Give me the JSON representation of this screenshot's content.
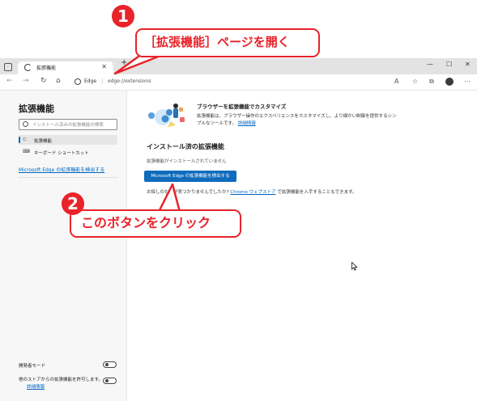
{
  "browser": {
    "tab_title": "拡張機能",
    "tab_close": "✕",
    "new_tab": "+",
    "address_site": "Edge",
    "address_separator": "|",
    "address_url": "edge://extensions",
    "window_controls": [
      "—",
      "☐",
      "✕"
    ]
  },
  "sidebar": {
    "title": "拡張機能",
    "search_placeholder": "インストール済みの拡張機能の検索",
    "nav_items": [
      {
        "label": "拡張機能"
      },
      {
        "label": "キーボード ショートカット"
      }
    ],
    "store_link": "Microsoft Edge の拡張機能を検出する",
    "toggles": [
      {
        "label": "開発者モード",
        "link": ""
      },
      {
        "label": "他のストアからの拡張機能を許可します。",
        "link": "詳細情報"
      }
    ]
  },
  "main": {
    "promo_title": "ブラウザーを拡張機能でカスタマイズ",
    "promo_desc": "拡張機能は、ブラウザー操作のエクスペリエンスをカスタマイズし、より細かい制御を提供するシンプルなツールです。",
    "promo_link": "詳細情報",
    "section_title": "インストール済の拡張機能",
    "empty_text": "拡張機能がインストールされていません",
    "discover_button": "Microsoft Edge の拡張機能を検出する",
    "hint_prefix": "お探しのもの",
    "hint_mid": "が見つかりませんでしたか?",
    "hint_link": "Chrome ウェブストア",
    "hint_suffix": "で拡張機能を入手することもできます。"
  },
  "annotations": {
    "callout_1_number": "1",
    "callout_1_text": "［拡張機能］ページを開く",
    "callout_2_number": "2",
    "callout_2_text": "このボタンをクリック"
  },
  "colors": {
    "annotation_red": "#e8232a",
    "primary_blue": "#0f6cbd",
    "link_blue": "#0067c0"
  }
}
